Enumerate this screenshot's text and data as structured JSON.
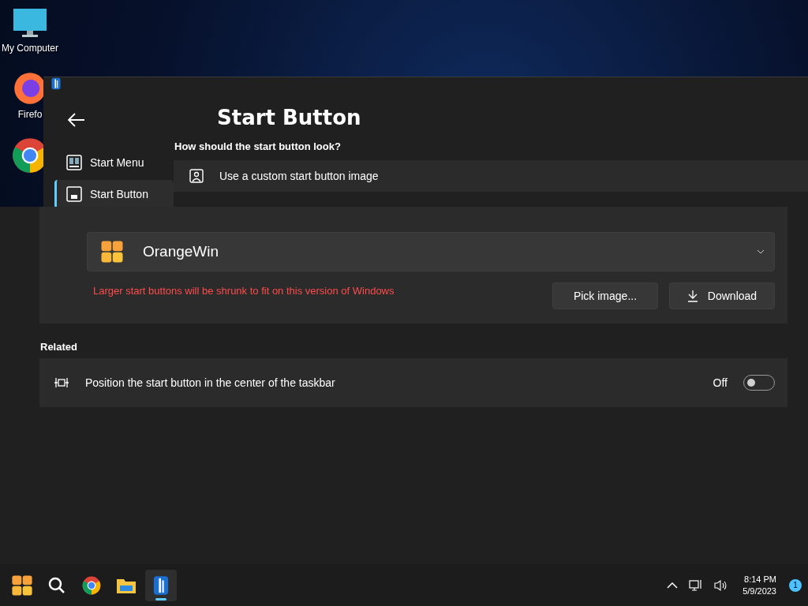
{
  "desktop_icons": [
    {
      "kind": "computer",
      "label": "My Computer"
    },
    {
      "kind": "firefox",
      "label": "Firefo"
    },
    {
      "kind": "chrome"
    }
  ],
  "window": {
    "nav": [
      {
        "kind": "menu",
        "label": "Start Menu",
        "selected": false
      },
      {
        "kind": "button",
        "label": "Start Button",
        "selected": true
      }
    ],
    "title": "Start Button",
    "question": "How should the start button look?",
    "expander_label": "Use a custom start button image",
    "dropdown_value": "OrangeWin",
    "warning": "Larger start buttons will be shrunk to fit on this version of Windows",
    "buttons": [
      {
        "kind": "pick",
        "label": "Pick image..."
      },
      {
        "kind": "download",
        "label": "Download"
      }
    ],
    "related_heading": "Related",
    "related": [
      {
        "label": "Position the start button in the center of the taskbar",
        "state_text": "Off",
        "on": false
      }
    ]
  },
  "taskbar": {
    "apps": [
      {
        "kind": "start",
        "selected": false
      },
      {
        "kind": "search",
        "selected": false
      },
      {
        "kind": "chrome",
        "selected": false
      },
      {
        "kind": "folder",
        "selected": false
      },
      {
        "kind": "app",
        "selected": true
      }
    ],
    "time": "8:14 PM",
    "date": "5/9/2023",
    "notification_count": "1"
  }
}
